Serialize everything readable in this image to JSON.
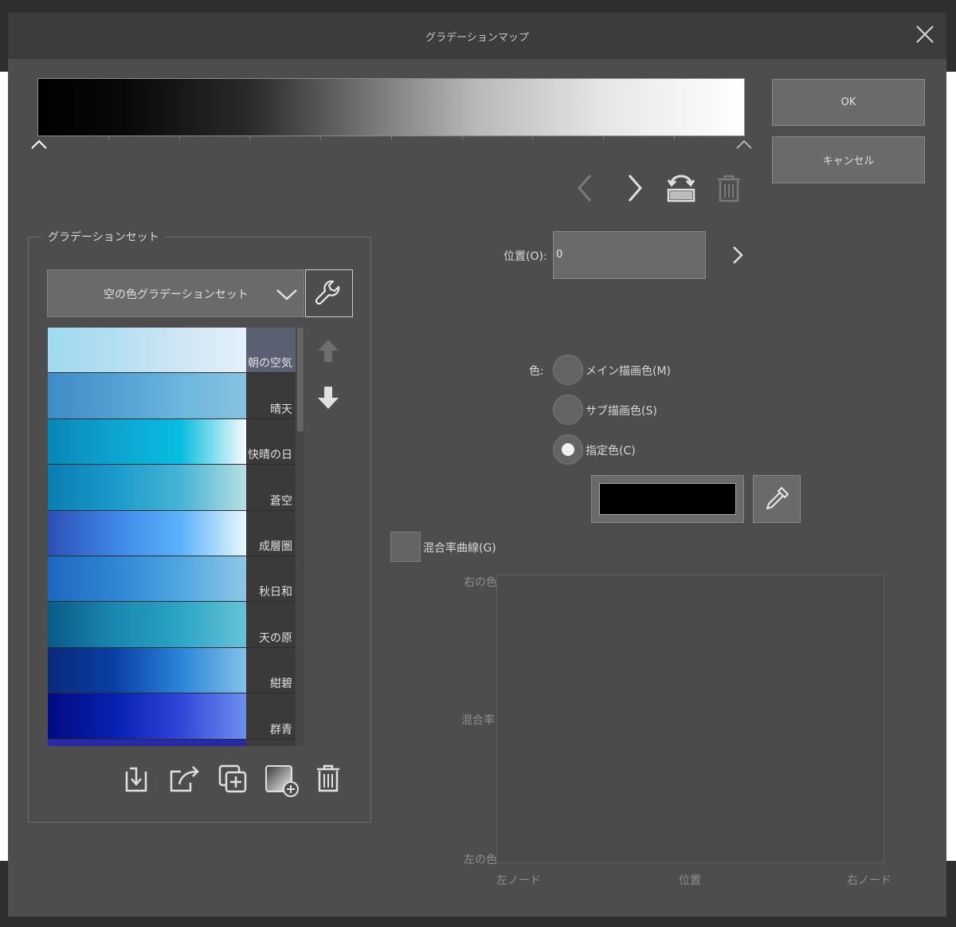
{
  "dialog": {
    "title": "グラデーションマップ"
  },
  "buttons": {
    "ok_label": "OK",
    "cancel_label": "キャンセル"
  },
  "gradient": {
    "start_color": "#000000",
    "end_color": "#ffffff"
  },
  "gradient_set": {
    "group_label": "グラデーションセット",
    "selected_set": "空の色グラデーションセット",
    "items": [
      {
        "label": "朝の空気",
        "selected": true,
        "colors": [
          "#9fd9f0",
          "#b3def2",
          "#cfe6f4",
          "#e4effa"
        ]
      },
      {
        "label": "晴天",
        "colors": [
          "#3f8cc7",
          "#519fd3",
          "#6cb6dd",
          "#87c2df"
        ]
      },
      {
        "label": "快晴の日",
        "colors": [
          "#0a86b7",
          "#0ea3cf",
          "#07bce0",
          "#f5fcfe"
        ]
      },
      {
        "label": "蒼空",
        "colors": [
          "#0b7db1",
          "#1a9acb",
          "#46b3d4",
          "#b6dfe2"
        ]
      },
      {
        "label": "成層圏",
        "colors": [
          "#2d4fb5",
          "#3d86e6",
          "#5ab1fa",
          "#e8f8fd"
        ]
      },
      {
        "label": "秋日和",
        "colors": [
          "#1e67c0",
          "#2f85d4",
          "#4fa6e0",
          "#90c6e6"
        ]
      },
      {
        "label": "天の原",
        "colors": [
          "#0b5a88",
          "#1a87b0",
          "#2ba5c5",
          "#67c2d6"
        ]
      },
      {
        "label": "紺碧",
        "colors": [
          "#0a2a7a",
          "#0a3fa6",
          "#2a84d8",
          "#82c1ea"
        ]
      },
      {
        "label": "群青",
        "colors": [
          "#020c82",
          "#0621b0",
          "#2f46d8",
          "#6d8ff0"
        ]
      }
    ],
    "next_partial_color": "#2a2aa8"
  },
  "position": {
    "label": "位置(O):",
    "value": "0"
  },
  "color": {
    "label": "色:",
    "main_label": "メイン描画色(M)",
    "sub_label": "サブ描画色(S)",
    "specified_label": "指定色(C)",
    "specified_value": "#000000"
  },
  "blend": {
    "checkbox_label": "混合率曲線(G)",
    "y_top": "右の色",
    "y_mid": "混合率",
    "y_bottom": "左の色",
    "x_left": "左ノード",
    "x_mid": "位置",
    "x_right": "右ノード"
  }
}
